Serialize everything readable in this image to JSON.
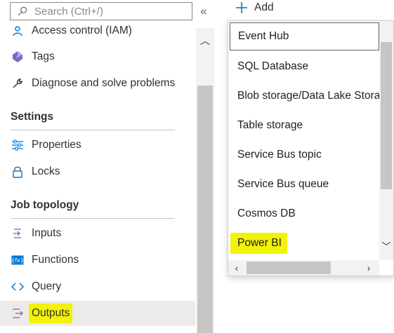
{
  "search": {
    "placeholder": "Search (Ctrl+/)",
    "icon": "search-icon"
  },
  "collapse_label": "«",
  "nav": {
    "items_top": [
      {
        "label": "Access control (IAM)",
        "icon": "person-icon"
      },
      {
        "label": "Tags",
        "icon": "tag-icon"
      },
      {
        "label": "Diagnose and solve problems",
        "icon": "wrench-icon"
      }
    ],
    "settings_header": "Settings",
    "settings_items": [
      {
        "label": "Properties",
        "icon": "sliders-icon"
      },
      {
        "label": "Locks",
        "icon": "lock-icon"
      }
    ],
    "job_topology_header": "Job topology",
    "job_items": [
      {
        "label": "Inputs",
        "icon": "input-icon"
      },
      {
        "label": "Functions",
        "icon": "function-icon"
      },
      {
        "label": "Query",
        "icon": "code-icon"
      },
      {
        "label": "Outputs",
        "icon": "output-icon",
        "selected": true
      }
    ]
  },
  "add": {
    "label": "Add",
    "icon": "plus-icon"
  },
  "dropdown": {
    "items": [
      {
        "label": "Event Hub"
      },
      {
        "label": "SQL Database"
      },
      {
        "label": "Blob storage/Data Lake Stora"
      },
      {
        "label": "Table storage"
      },
      {
        "label": "Service Bus topic"
      },
      {
        "label": "Service Bus queue"
      },
      {
        "label": "Cosmos DB"
      },
      {
        "label": "Power BI"
      }
    ]
  },
  "scroll_glyphs": {
    "up": "︿",
    "down": "﹀",
    "left": "‹",
    "right": "›"
  },
  "colors": {
    "highlight": "#f2f20a",
    "accent": "#0078d4",
    "selected_bg": "#edebe9"
  }
}
